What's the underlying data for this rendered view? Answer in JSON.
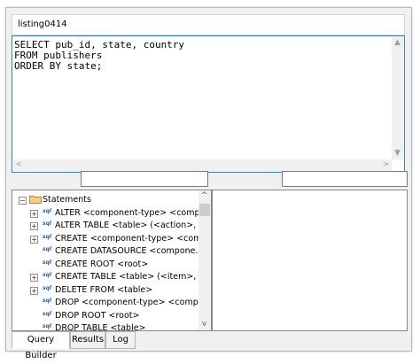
{
  "window_title": "listing0414",
  "sql": {
    "lines": [
      "SELECT pub_id, state, country",
      "FROM publishers",
      "ORDER BY state;"
    ]
  },
  "filters": {
    "left_value": "",
    "right_value": ""
  },
  "tree": {
    "root_label": "Statements",
    "root_expander": "⊟",
    "items": [
      {
        "label": "ALTER <component-type> <comp...",
        "expander": "+"
      },
      {
        "label": "ALTER TABLE <table> (<action>, ...",
        "expander": "+"
      },
      {
        "label": "CREATE <component-type> <com...",
        "expander": "+"
      },
      {
        "label": "CREATE DATASOURCE <compone...",
        "expander": ""
      },
      {
        "label": "CREATE ROOT <root>",
        "expander": ""
      },
      {
        "label": "CREATE TABLE <table> (<item>, ...",
        "expander": "+"
      },
      {
        "label": "DELETE FROM <table>",
        "expander": "+"
      },
      {
        "label": "DROP <component-type> <compo...",
        "expander": ""
      },
      {
        "label": "DROP ROOT <root>",
        "expander": ""
      },
      {
        "label": "DROP TABLE <table>",
        "expander": ""
      }
    ],
    "sql_icon_text": "sql"
  },
  "tabs": [
    {
      "label": "Query Builder",
      "active": true
    },
    {
      "label": "Results",
      "active": false
    },
    {
      "label": "Log",
      "active": false
    }
  ],
  "icons": {
    "scroll_up": "▲",
    "scroll_down": "▼",
    "scroll_left": "<",
    "scroll_right": ">",
    "tree_up": "^",
    "tree_down": "v"
  }
}
